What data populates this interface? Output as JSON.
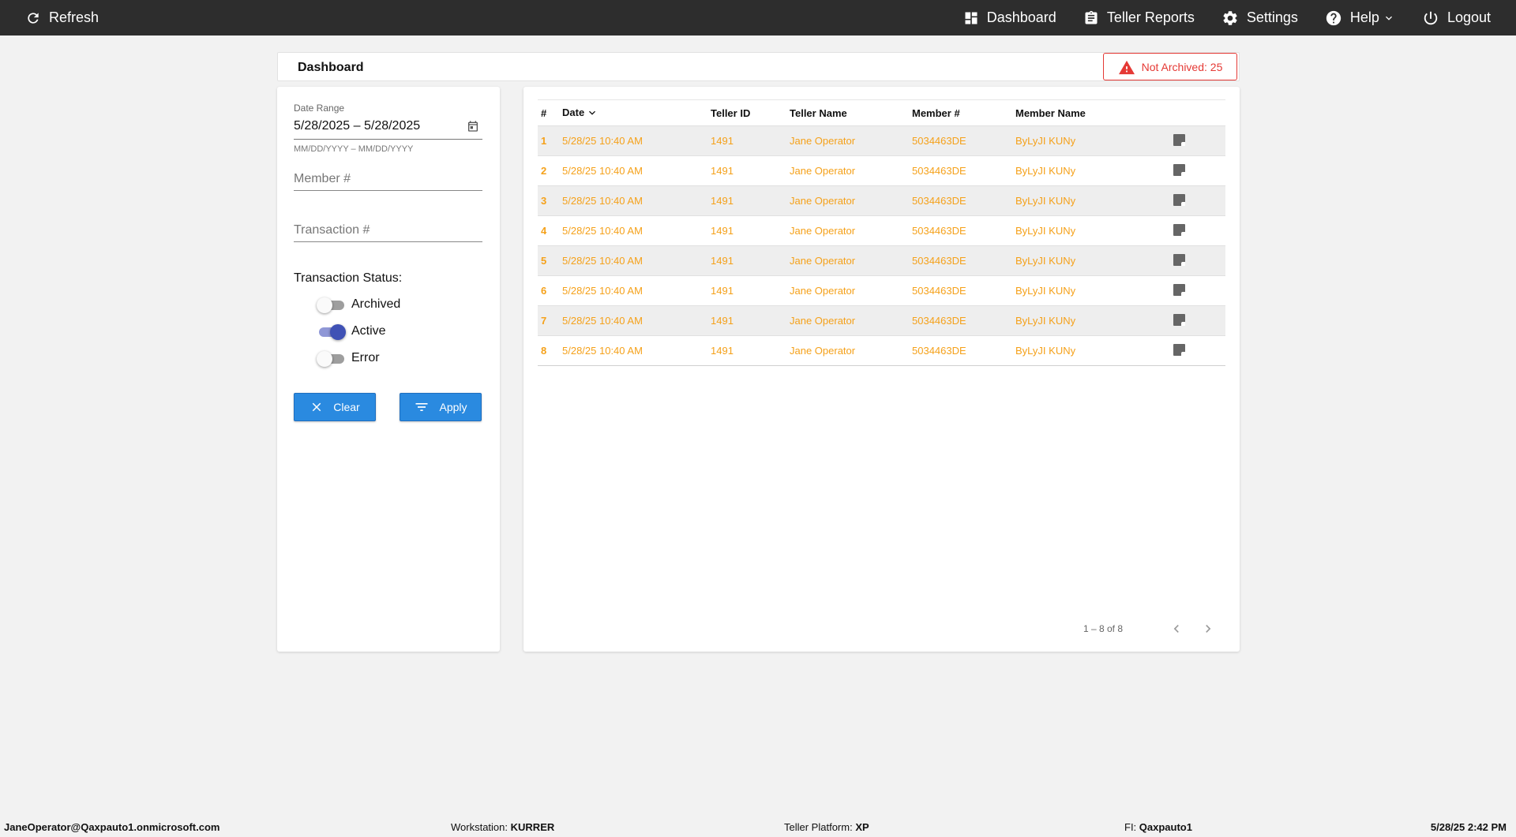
{
  "topbar": {
    "refresh_label": "Refresh",
    "nav": [
      {
        "label": "Dashboard",
        "icon": "dashboard-icon"
      },
      {
        "label": "Teller Reports",
        "icon": "clipboard-icon"
      },
      {
        "label": "Settings",
        "icon": "gear-icon"
      },
      {
        "label": "Help",
        "icon": "help-icon"
      },
      {
        "label": "Logout",
        "icon": "power-icon"
      }
    ]
  },
  "header": {
    "title": "Dashboard",
    "alert_text": "Not Archived: 25",
    "alert_color": "#e53935"
  },
  "filters": {
    "date_range_label": "Date Range",
    "date_range_value": "5/28/2025 – 5/28/2025",
    "date_range_hint": "MM/DD/YYYY – MM/DD/YYYY",
    "member_placeholder": "Member #",
    "transaction_placeholder": "Transaction #",
    "status_title": "Transaction Status:",
    "statuses": [
      {
        "label": "Archived",
        "checked": false
      },
      {
        "label": "Active",
        "checked": true
      },
      {
        "label": "Error",
        "checked": false
      }
    ],
    "clear_label": "Clear",
    "apply_label": "Apply",
    "button_color": "#2a8ae0"
  },
  "table": {
    "columns": [
      "#",
      "Date",
      "Teller ID",
      "Teller Name",
      "Member #",
      "Member Name"
    ],
    "row_color": "#f5a11a",
    "rows": [
      [
        "1",
        "5/28/25 10:40 AM",
        "1491",
        "Jane Operator",
        "5034463DE",
        "ByLyJI KUNy"
      ],
      [
        "2",
        "5/28/25 10:40 AM",
        "1491",
        "Jane Operator",
        "5034463DE",
        "ByLyJI KUNy"
      ],
      [
        "3",
        "5/28/25 10:40 AM",
        "1491",
        "Jane Operator",
        "5034463DE",
        "ByLyJI KUNy"
      ],
      [
        "4",
        "5/28/25 10:40 AM",
        "1491",
        "Jane Operator",
        "5034463DE",
        "ByLyJI KUNy"
      ],
      [
        "5",
        "5/28/25 10:40 AM",
        "1491",
        "Jane Operator",
        "5034463DE",
        "ByLyJI KUNy"
      ],
      [
        "6",
        "5/28/25 10:40 AM",
        "1491",
        "Jane Operator",
        "5034463DE",
        "ByLyJI KUNy"
      ],
      [
        "7",
        "5/28/25 10:40 AM",
        "1491",
        "Jane Operator",
        "5034463DE",
        "ByLyJI KUNy"
      ],
      [
        "8",
        "5/28/25 10:40 AM",
        "1491",
        "Jane Operator",
        "5034463DE",
        "ByLyJI KUNy"
      ]
    ],
    "pager_range": "1 – 8 of 8"
  },
  "footer": {
    "user": "JaneOperator@Qaxpauto1.onmicrosoft.com",
    "workstation_label": "Workstation:",
    "workstation_value": "KURRER",
    "platform_label": "Teller Platform:",
    "platform_value": "XP",
    "fi_label": "FI:",
    "fi_value": "Qaxpauto1",
    "datetime": "5/28/25 2:42 PM"
  }
}
